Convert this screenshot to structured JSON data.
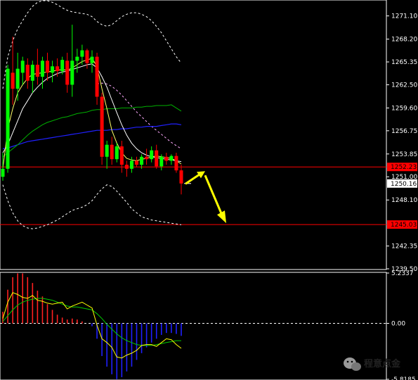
{
  "chart_data": [
    {
      "type": "candlestick",
      "ylim": [
        1239.5,
        1273.0
      ],
      "ticks": [
        "1271.10",
        "1268.20",
        "1265.35",
        "1262.50",
        "1259.60",
        "1256.75",
        "1253.85",
        "1251.00",
        "1248.10",
        "1242.35",
        "1239.50"
      ],
      "tick_values": [
        1271.1,
        1268.2,
        1265.35,
        1262.5,
        1259.6,
        1256.75,
        1253.85,
        1251.0,
        1248.1,
        1242.35,
        1239.5
      ],
      "price_lines": [
        {
          "label": "1252.23",
          "value": 1252.23,
          "color": "#ff0000"
        },
        {
          "label": "1245.03",
          "value": 1245.03,
          "color": "#ff0000"
        }
      ],
      "current_price": {
        "label": "1250.16",
        "value": 1250.16
      },
      "candles": [
        [
          1251.0,
          1254.0,
          1250.5,
          1252.0
        ],
        [
          1252.0,
          1265.0,
          1251.5,
          1264.5
        ],
        [
          1264.0,
          1268.5,
          1260.0,
          1262.0
        ],
        [
          1262.0,
          1266.5,
          1260.5,
          1264.5
        ],
        [
          1264.0,
          1266.0,
          1262.5,
          1265.5
        ],
        [
          1265.0,
          1265.8,
          1262.0,
          1263.0
        ],
        [
          1263.0,
          1265.5,
          1261.5,
          1265.0
        ],
        [
          1265.0,
          1267.0,
          1262.5,
          1263.5
        ],
        [
          1263.5,
          1266.0,
          1262.0,
          1265.5
        ],
        [
          1265.5,
          1266.5,
          1263.0,
          1264.0
        ],
        [
          1264.0,
          1265.5,
          1262.8,
          1264.8
        ],
        [
          1264.8,
          1265.8,
          1263.5,
          1264.2
        ],
        [
          1264.2,
          1266.0,
          1263.8,
          1265.6
        ],
        [
          1265.5,
          1266.5,
          1261.5,
          1262.5
        ],
        [
          1262.5,
          1270.0,
          1261.0,
          1265.5
        ],
        [
          1265.5,
          1267.0,
          1264.0,
          1266.0
        ],
        [
          1266.0,
          1267.5,
          1265.0,
          1266.8
        ],
        [
          1266.8,
          1267.0,
          1264.5,
          1265.2
        ],
        [
          1265.2,
          1266.8,
          1264.0,
          1266.0
        ],
        [
          1266.0,
          1266.5,
          1260.0,
          1261.0
        ],
        [
          1261.0,
          1261.5,
          1252.5,
          1253.5
        ],
        [
          1253.5,
          1255.5,
          1252.0,
          1255.0
        ],
        [
          1255.0,
          1256.0,
          1252.5,
          1253.2
        ],
        [
          1253.2,
          1255.2,
          1252.8,
          1254.8
        ],
        [
          1254.8,
          1255.5,
          1251.5,
          1252.5
        ],
        [
          1252.5,
          1253.0,
          1251.0,
          1252.0
        ],
        [
          1252.0,
          1253.5,
          1251.5,
          1253.0
        ],
        [
          1253.0,
          1253.5,
          1252.2,
          1252.5
        ],
        [
          1252.5,
          1253.8,
          1252.0,
          1253.5
        ],
        [
          1253.5,
          1254.5,
          1252.5,
          1253.2
        ],
        [
          1253.2,
          1254.8,
          1252.8,
          1254.3
        ],
        [
          1254.3,
          1255.0,
          1252.0,
          1252.3
        ],
        [
          1252.3,
          1253.8,
          1251.8,
          1253.5
        ],
        [
          1253.5,
          1254.0,
          1252.5,
          1253.0
        ],
        [
          1253.0,
          1253.8,
          1252.5,
          1253.6
        ],
        [
          1253.6,
          1254.0,
          1251.5,
          1251.8
        ],
        [
          1251.8,
          1252.5,
          1248.8,
          1250.16
        ]
      ],
      "bollinger_upper": [
        1262.0,
        1266.0,
        1268.0,
        1269.5,
        1270.5,
        1271.5,
        1272.3,
        1272.8,
        1273.0,
        1273.0,
        1272.8,
        1272.5,
        1272.1,
        1271.8,
        1271.6,
        1271.5,
        1271.4,
        1271.3,
        1271.0,
        1270.4,
        1270.0,
        1269.8,
        1270.0,
        1270.5,
        1271.0,
        1271.3,
        1271.5,
        1271.5,
        1271.3,
        1271.0,
        1270.5,
        1269.8,
        1269.0,
        1268.0,
        1267.0,
        1266.0,
        1265.2
      ],
      "bollinger_lower": [
        1250.0,
        1248.0,
        1246.5,
        1245.5,
        1244.9,
        1244.6,
        1244.5,
        1244.6,
        1244.8,
        1245.0,
        1245.3,
        1245.6,
        1246.0,
        1246.4,
        1246.8,
        1247.0,
        1247.2,
        1247.5,
        1248.0,
        1248.8,
        1249.5,
        1250.0,
        1249.8,
        1249.2,
        1248.5,
        1247.8,
        1247.0,
        1246.5,
        1246.0,
        1245.8,
        1245.6,
        1245.5,
        1245.4,
        1245.3,
        1245.2,
        1245.1,
        1245.0
      ],
      "ma_fast": [
        1252.0,
        1257.0,
        1259.5,
        1261.5,
        1262.5,
        1263.3,
        1263.8,
        1263.9,
        1264.0,
        1264.1,
        1264.2,
        1264.3,
        1264.4,
        1264.3,
        1264.6,
        1265.0,
        1265.4,
        1265.6,
        1265.8,
        1264.8,
        1262.0,
        1259.5,
        1256.8,
        1255.2,
        1254.0,
        1253.3,
        1253.1,
        1253.0,
        1253.2,
        1253.3,
        1253.5,
        1253.6,
        1253.5,
        1253.4,
        1253.3,
        1253.0,
        1252.6
      ],
      "ma_mid": [
        1254.0,
        1255.0,
        1256.5,
        1258.0,
        1259.5,
        1260.5,
        1261.5,
        1262.2,
        1262.8,
        1263.3,
        1263.6,
        1263.9,
        1264.1,
        1264.2,
        1264.4,
        1264.6,
        1264.8,
        1265.0,
        1265.1,
        1264.6,
        1263.5,
        1262.2,
        1260.6,
        1259.0,
        1257.5,
        1256.2,
        1255.2,
        1254.5,
        1254.0,
        1253.7,
        1253.5,
        1253.4,
        1253.3,
        1253.2,
        1253.1,
        1253.0,
        1252.9
      ],
      "ma_upper_dash": [
        null,
        null,
        null,
        null,
        null,
        null,
        null,
        null,
        null,
        null,
        null,
        null,
        null,
        null,
        null,
        null,
        null,
        null,
        null,
        1262.6,
        1262.7,
        1262.6,
        1262.3,
        1261.8,
        1261.2,
        1260.5,
        1259.8,
        1259.1,
        1258.5,
        1257.9,
        1257.3,
        1256.8,
        1256.3,
        1255.8,
        1255.3,
        1254.9,
        1254.5
      ],
      "ma_green": [
        1253.5,
        1254.0,
        1254.5,
        1255.0,
        1255.6,
        1256.2,
        1256.7,
        1257.1,
        1257.5,
        1257.8,
        1258.0,
        1258.2,
        1258.4,
        1258.5,
        1258.7,
        1258.9,
        1259.0,
        1259.1,
        1259.3,
        1259.4,
        1259.4,
        1259.5,
        1259.5,
        1259.5,
        1259.6,
        1259.6,
        1259.6,
        1259.7,
        1259.7,
        1259.8,
        1259.8,
        1259.9,
        1259.9,
        1259.9,
        1260.0,
        1259.6,
        1259.2
      ],
      "ma_blue": [
        1254.5,
        1254.6,
        1254.8,
        1255.0,
        1255.2,
        1255.4,
        1255.5,
        1255.6,
        1255.7,
        1255.8,
        1255.9,
        1256.0,
        1256.1,
        1256.2,
        1256.3,
        1256.4,
        1256.5,
        1256.6,
        1256.7,
        1256.8,
        1256.8,
        1256.8,
        1256.9,
        1256.9,
        1257.0,
        1257.0,
        1257.1,
        1257.2,
        1257.2,
        1257.3,
        1257.3,
        1257.3,
        1257.4,
        1257.5,
        1257.6,
        1257.6,
        1257.5
      ]
    },
    {
      "type": "macd",
      "ylim": [
        -5.8185,
        5.2337
      ],
      "ticks": [
        "5.2337",
        "0.00",
        "-5.8185"
      ],
      "tick_values": [
        5.2337,
        0.0,
        -5.8185
      ],
      "histogram": [
        1.2,
        3.5,
        4.8,
        5.2,
        5.2,
        4.8,
        4.2,
        3.4,
        2.8,
        2.0,
        1.4,
        0.9,
        0.6,
        0.4,
        0.5,
        0.4,
        0.2,
        0.0,
        -0.3,
        -1.6,
        -3.4,
        -4.5,
        -5.3,
        -5.8,
        -5.6,
        -5.0,
        -4.5,
        -3.8,
        -3.1,
        -2.5,
        -2.0,
        -1.6,
        -1.2,
        -1.0,
        -1.0,
        -1.1,
        -1.3
      ],
      "signal": [
        0.2,
        0.8,
        1.4,
        1.9,
        2.2,
        2.4,
        2.5,
        2.6,
        2.6,
        2.5,
        2.4,
        2.2,
        2.0,
        1.8,
        1.7,
        1.7,
        1.6,
        1.5,
        1.4,
        1.0,
        0.5,
        -0.1,
        -0.6,
        -1.1,
        -1.5,
        -1.8,
        -2.0,
        -2.2,
        -2.3,
        -2.3,
        -2.3,
        -2.2,
        -2.1,
        -2.0,
        -1.9,
        -1.8,
        -1.8
      ],
      "macd_line": [
        0.5,
        2.2,
        3.2,
        3.0,
        2.7,
        2.6,
        2.9,
        2.4,
        2.3,
        2.1,
        2.0,
        2.1,
        2.2,
        1.5,
        1.8,
        2.0,
        2.2,
        1.9,
        1.6,
        -0.2,
        -1.6,
        -2.0,
        -2.5,
        -3.5,
        -3.6,
        -3.3,
        -3.1,
        -2.8,
        -2.3,
        -2.2,
        -2.2,
        -2.4,
        -2.0,
        -1.6,
        -1.7,
        -2.2,
        -2.6
      ]
    }
  ],
  "watermark": {
    "text": "程意点金",
    "icon": "wechat-icon"
  },
  "colors": {
    "bull": "#00ff00",
    "bear": "#ff0000",
    "grid": "#ffffff",
    "price_line": "#ff0000",
    "arrow": "#ffff00",
    "ma_fast": "#ffff66",
    "ma_mid": "#ffffff",
    "ma_dash": "#ffaaff",
    "ma_green": "#00b000",
    "ma_blue": "#2020ff",
    "bb": "#ffffff",
    "macd_pos": "#ff2020",
    "macd_neg": "#2020ff",
    "signal": "#ffff00",
    "macd_line": "#00cc00"
  }
}
